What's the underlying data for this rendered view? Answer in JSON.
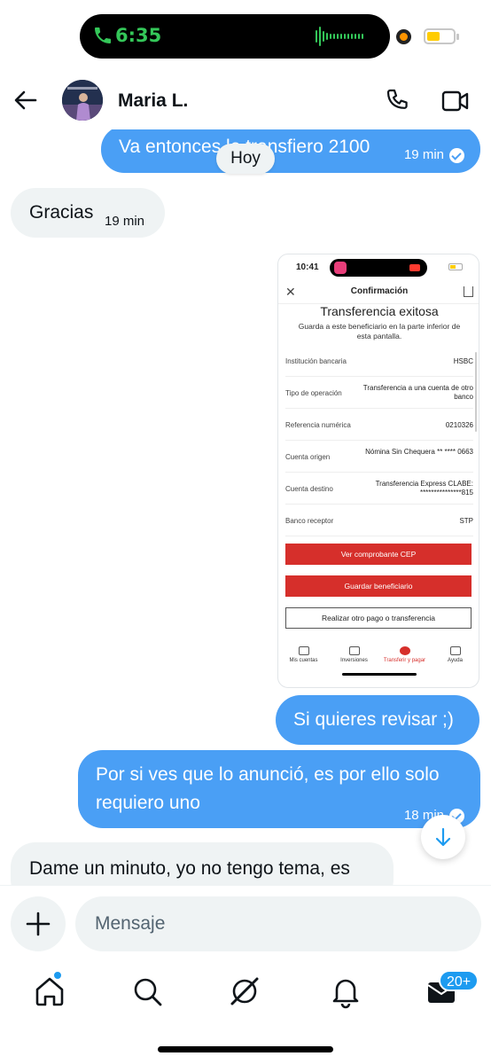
{
  "status_bar": {
    "time": "6:35",
    "colors": {
      "call_green": "#34c759",
      "battery_yellow": "#ffcc00"
    }
  },
  "header": {
    "contact_name": "Maria L.",
    "icons": [
      "back-arrow-icon",
      "phone-icon",
      "video-icon"
    ]
  },
  "date_chip": "Hoy",
  "messages": [
    {
      "direction": "out",
      "text": "Va entonces le transfiero 2100",
      "time": "19 min",
      "read": true
    },
    {
      "direction": "in",
      "text": "Gracias",
      "time": "19 min"
    },
    {
      "direction": "out",
      "type": "image"
    },
    {
      "direction": "out",
      "text": "Si quieres revisar ;)"
    },
    {
      "direction": "out",
      "text": "Por si ves que lo anunció, es por ello solo requiero uno",
      "time": "18 min",
      "read": true
    },
    {
      "direction": "in",
      "text": "Dame un minuto, yo no tengo tema, es"
    }
  ],
  "embedded_screenshot": {
    "time": "10:41",
    "header_title": "Confirmación",
    "title": "Transferencia exitosa",
    "subtitle": "Guarda a este beneficiario en la parte inferior de esta pantalla.",
    "rows": [
      {
        "label": "Institución bancaria",
        "value": "HSBC"
      },
      {
        "label": "Tipo de operación",
        "value": "Transferencia a una cuenta de otro banco"
      },
      {
        "label": "Referencia numérica",
        "value": "0210326"
      },
      {
        "label": "Cuenta origen",
        "value": "Nómina Sin Chequera ** **** 0663"
      },
      {
        "label": "Cuenta destino",
        "value": "Transferencia Express CLABE: ***************815"
      },
      {
        "label": "Banco receptor",
        "value": "STP"
      }
    ],
    "buttons": [
      "Ver comprobante CEP",
      "Guardar beneficiario",
      "Realizar otro pago o transferencia"
    ],
    "tabs": [
      "Mis cuentas",
      "Inversiones",
      "Transferir y pagar",
      "Ayuda"
    ],
    "active_tab": "Transferir y pagar",
    "accent_color": "#d62f2b"
  },
  "composer": {
    "placeholder": "Mensaje"
  },
  "bottom_nav": {
    "items": [
      "home-icon",
      "search-icon",
      "grok-icon",
      "notifications-icon",
      "messages-icon"
    ],
    "messages_badge": "20+"
  },
  "colors": {
    "outgoing_bubble": "#4a9ff5",
    "incoming_bubble": "#eff3f4",
    "accent": "#1d9bf0"
  }
}
